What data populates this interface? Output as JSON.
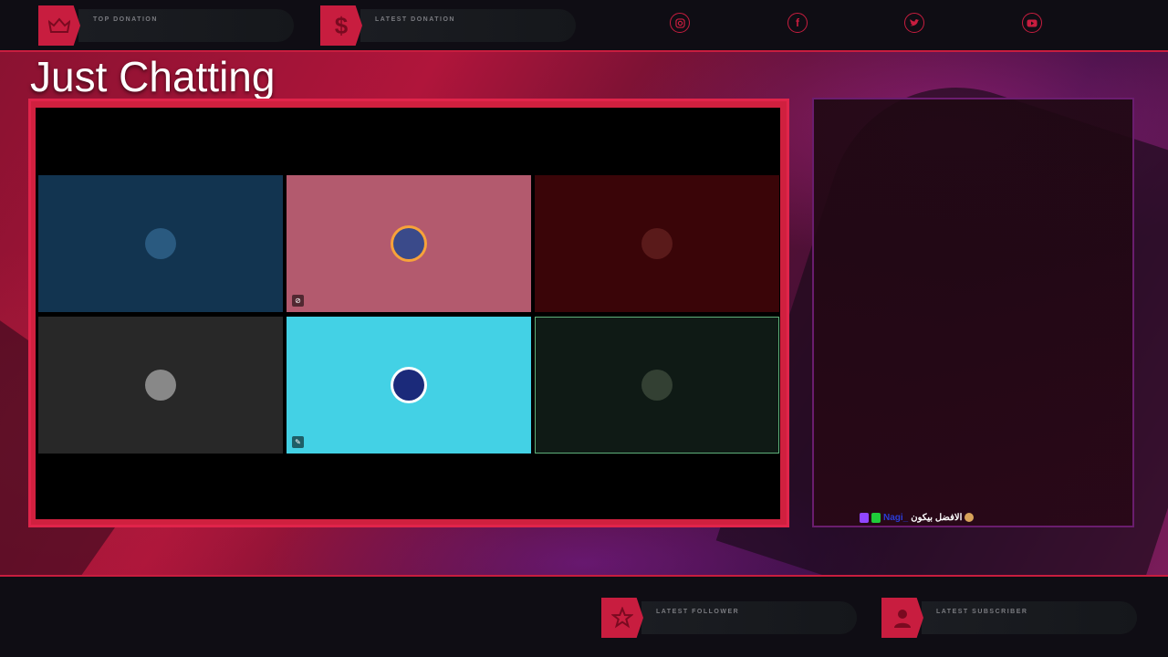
{
  "top_bar": {
    "widgets": [
      {
        "label": "TOP DONATION",
        "icon": "crown-icon"
      },
      {
        "label": "LATEST DONATION",
        "icon": "dollar-icon"
      }
    ],
    "socials": [
      "instagram-icon",
      "facebook-icon",
      "twitter-icon",
      "youtube-icon"
    ]
  },
  "main": {
    "title": "Just Chatting",
    "call_tiles": [
      {
        "color": "#123450",
        "avatar_color": "#2a5a80",
        "icon": ""
      },
      {
        "color": "#b35a6e",
        "avatar_color": "#3a4a8a",
        "icon": "mute-icon"
      },
      {
        "color": "#3a0508",
        "avatar_color": "#5a1a1a",
        "icon": ""
      },
      {
        "color": "#282828",
        "avatar_color": "#888888",
        "icon": ""
      },
      {
        "color": "#43d1e5",
        "avatar_color": "#1b2a7a",
        "icon": "edit-icon"
      },
      {
        "color": "#0f1a15",
        "avatar_color": "#334033",
        "icon": ""
      }
    ]
  },
  "chat": {
    "messages": [
      {
        "username": "Nagi_",
        "text": "الافضل بيكون"
      }
    ]
  },
  "bottom_bar": {
    "widgets": [
      {
        "label": "LATEST FOLLOWER",
        "icon": "star-icon"
      },
      {
        "label": "LATEST SUBSCRIBER",
        "icon": "user-icon"
      }
    ]
  },
  "colors": {
    "accent": "#c81d3f",
    "background": "#0d0a12"
  }
}
